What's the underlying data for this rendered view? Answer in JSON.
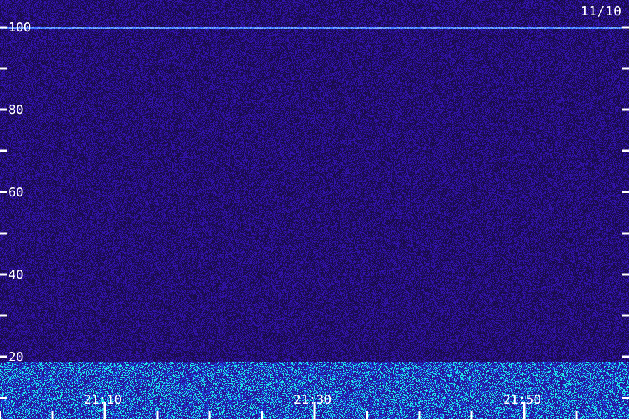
{
  "chart_data": {
    "type": "heatmap",
    "title": "",
    "date": "11/10",
    "xlabel": "",
    "ylabel": "",
    "y_ticks": [
      20,
      40,
      60,
      80,
      100
    ],
    "y_minor_ticks": [
      10,
      30,
      50,
      70,
      90
    ],
    "ylim": [
      0,
      102
    ],
    "x_ticks": [
      "21:10",
      "21:30",
      "21:50"
    ],
    "x_tick_minutes": [
      10,
      30,
      50
    ],
    "x_minor_tick_minutes": [
      5,
      15,
      20,
      25,
      35,
      40,
      45,
      55
    ],
    "xlim_minutes": [
      0,
      60
    ],
    "grid": false,
    "colors": {
      "background": "#1a0c4a",
      "low": "#2a10a0",
      "mid": "#1e5cff",
      "high": "#18e0d0",
      "peak": "#e8f020",
      "axis": "#ffffff"
    },
    "features": [
      {
        "name": "narrowband line",
        "freq": 100
      },
      {
        "name": "bright band",
        "freq": 3
      }
    ]
  }
}
